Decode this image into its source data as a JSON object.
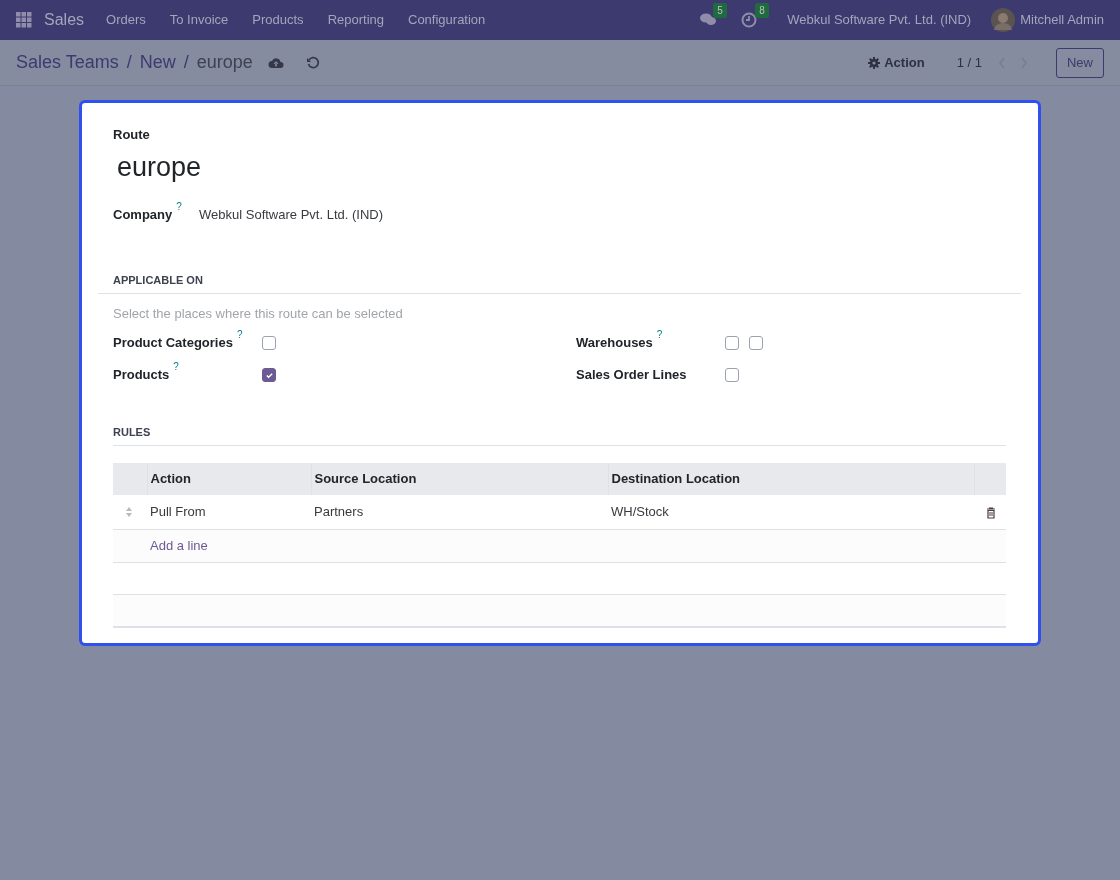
{
  "navbar": {
    "app": "Sales",
    "menu": [
      "Orders",
      "To Invoice",
      "Products",
      "Reporting",
      "Configuration"
    ],
    "messages_count": "5",
    "activities_count": "8",
    "company": "Webkul Software Pvt. Ltd. (IND)",
    "user": "Mitchell Admin"
  },
  "control_panel": {
    "breadcrumb_separator": "/",
    "breadcrumbs": [
      {
        "label": "Sales Teams",
        "kind": "link"
      },
      {
        "label": "New",
        "kind": "link"
      },
      {
        "label": "europe",
        "kind": "current"
      }
    ],
    "action": "Action",
    "pager": "1 / 1",
    "new_button": "New"
  },
  "form": {
    "name_label": "Route",
    "name": "europe",
    "company_label": "Company",
    "company_help": "?",
    "company": "Webkul Software Pvt. Ltd. (IND)",
    "applicable_heading": "APPLICABLE ON",
    "applicable_hint": "Select the places where this route can be selected",
    "applicable_left": [
      {
        "label": "Product Categories",
        "help": "?",
        "checks": [
          false
        ]
      },
      {
        "label": "Products",
        "help": "?",
        "checks": [
          true
        ]
      }
    ],
    "applicable_right": [
      {
        "label": "Warehouses",
        "help": "?",
        "checks": [
          false,
          false
        ]
      },
      {
        "label": "Sales Order Lines",
        "checks": [
          false
        ]
      }
    ],
    "rules_heading": "RULES",
    "rules_columns": [
      "Action",
      "Source Location",
      "Destination Location"
    ],
    "rules_rows": [
      [
        "Pull From",
        "Partners",
        "WH/Stock"
      ]
    ],
    "add_line": "Add a line"
  }
}
